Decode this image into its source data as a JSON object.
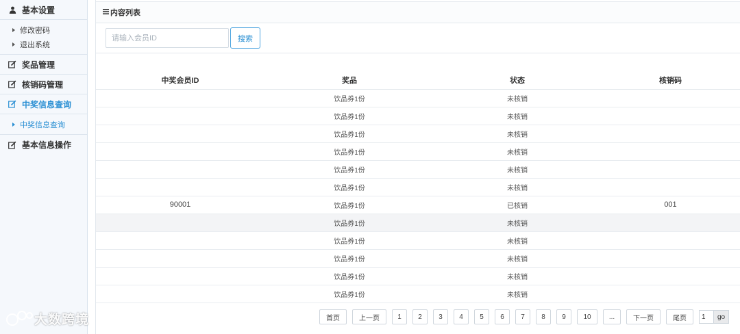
{
  "sidebar": {
    "basic_settings": "基本设置",
    "change_password": "修改密码",
    "logout": "退出系统",
    "prize_management": "奖品管理",
    "code_management": "核销码管理",
    "winner_query": "中奖信息查询",
    "winner_query_sub": "中奖信息查询",
    "basic_info_ops": "基本信息操作"
  },
  "watermark": {
    "text": "大数跨境"
  },
  "panel": {
    "title": "内容列表"
  },
  "search": {
    "placeholder": "请输入会员ID",
    "button": "搜索"
  },
  "table": {
    "headers": [
      "中奖会员ID",
      "奖品",
      "状态",
      "核销码"
    ],
    "rows": [
      [
        "",
        "饮品券1份",
        "未核销",
        ""
      ],
      [
        "",
        "饮品券1份",
        "未核销",
        ""
      ],
      [
        "",
        "饮品券1份",
        "未核销",
        ""
      ],
      [
        "",
        "饮品券1份",
        "未核销",
        ""
      ],
      [
        "",
        "饮品券1份",
        "未核销",
        ""
      ],
      [
        "",
        "饮品券1份",
        "未核销",
        ""
      ],
      [
        "90001",
        "饮品券1份",
        "已核销",
        "001"
      ],
      [
        "",
        "饮品券1份",
        "未核销",
        ""
      ],
      [
        "",
        "饮品券1份",
        "未核销",
        ""
      ],
      [
        "",
        "饮品券1份",
        "未核销",
        ""
      ],
      [
        "",
        "饮品券1份",
        "未核销",
        ""
      ],
      [
        "",
        "饮品券1份",
        "未核销",
        ""
      ]
    ]
  },
  "pagination": {
    "first": "首页",
    "prev": "上一页",
    "pages": [
      "1",
      "2",
      "3",
      "4",
      "5",
      "6",
      "7",
      "8",
      "9",
      "10"
    ],
    "ellipsis": "...",
    "next": "下一页",
    "last": "尾页",
    "current": "1",
    "go": "go"
  },
  "colors": {
    "accent": "#2a8fd3",
    "border": "#e3e8ee"
  }
}
